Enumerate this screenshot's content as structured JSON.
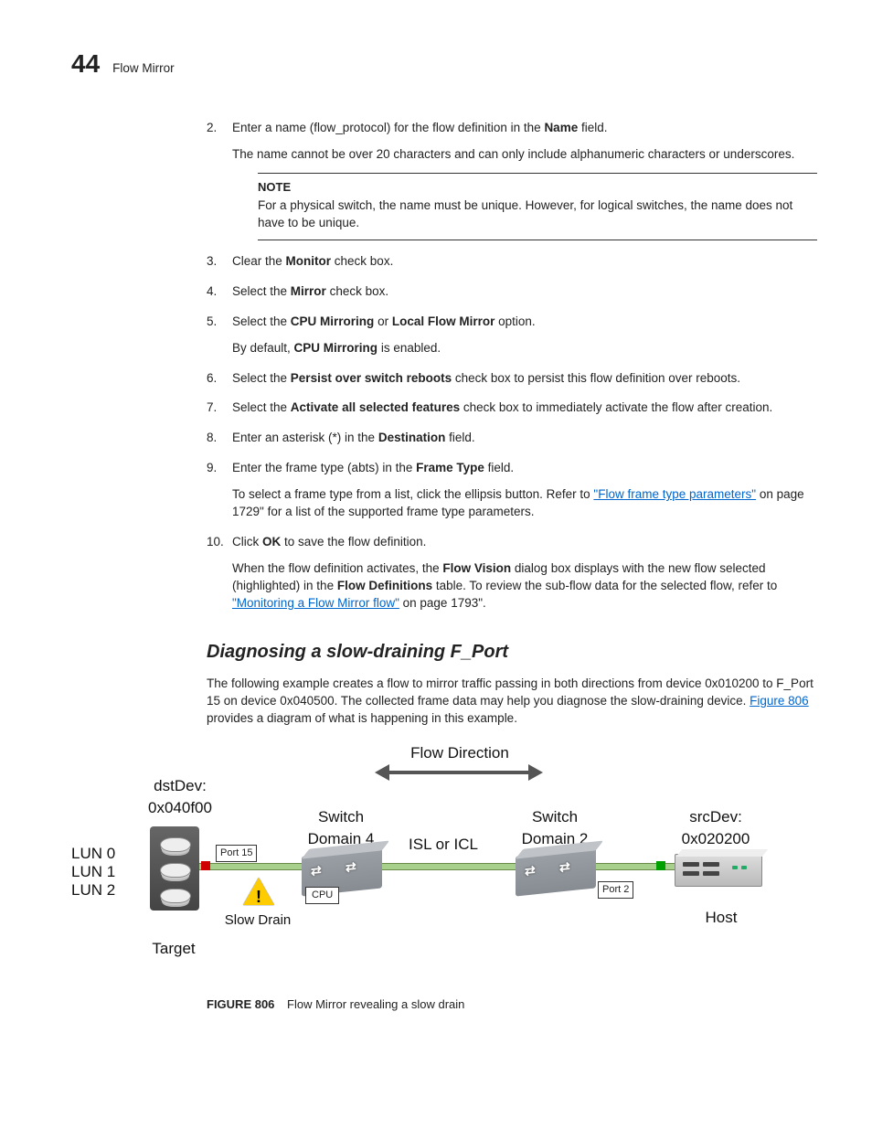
{
  "header": {
    "page_number": "44",
    "section_title": "Flow Mirror"
  },
  "steps": {
    "s2": {
      "num": "2.",
      "text_a": "Enter a name (flow_protocol) for the flow definition in the ",
      "bold_a": "Name",
      "text_b": " field.",
      "para": "The name cannot be over 20 characters and can only include alphanumeric characters or underscores."
    },
    "note": {
      "label": "NOTE",
      "text": "For a physical switch, the name must be unique. However, for logical switches, the name does not have to be unique."
    },
    "s3": {
      "num": "3.",
      "a": "Clear the ",
      "b": "Monitor",
      "c": " check box."
    },
    "s4": {
      "num": "4.",
      "a": "Select the ",
      "b": "Mirror",
      "c": " check box."
    },
    "s5": {
      "num": "5.",
      "a": "Select the ",
      "b": "CPU Mirroring",
      "c": " or ",
      "d": "Local Flow Mirror",
      "e": " option.",
      "para_a": "By default, ",
      "para_b": "CPU Mirroring",
      "para_c": " is enabled."
    },
    "s6": {
      "num": "6.",
      "a": "Select the ",
      "b": "Persist over switch reboots",
      "c": " check box to persist this flow definition over reboots."
    },
    "s7": {
      "num": "7.",
      "a": "Select the ",
      "b": "Activate all selected features",
      "c": " check box to immediately activate the flow after creation."
    },
    "s8": {
      "num": "8.",
      "a": "Enter an asterisk (*) in the ",
      "b": "Destination",
      "c": " field."
    },
    "s9": {
      "num": "9.",
      "a": "Enter the frame type (abts) in the ",
      "b": "Frame Type",
      "c": " field.",
      "para_a": "To select a frame type from a list, click the ellipsis button. Refer to ",
      "link": "\"Flow frame type parameters\"",
      "para_b": " on page 1729\" for a list of the supported frame type parameters."
    },
    "s10": {
      "num": "10.",
      "a": "Click ",
      "b": "OK",
      "c": " to save the flow definition.",
      "para_a": "When the flow definition activates, the ",
      "b2": "Flow Vision",
      "para_b": " dialog box displays with the new flow selected (highlighted) in the ",
      "b3": "Flow Definitions",
      "para_c": " table. To review the sub-flow data for the selected flow, refer to ",
      "link": "\"Monitoring a Flow Mirror flow\"",
      "para_d": " on page 1793\"."
    }
  },
  "section2": {
    "heading": "Diagnosing a slow-draining F_Port",
    "p_a": "The following example creates a flow to mirror traffic passing in both directions from device 0x010200 to F_Port 15 on device 0x040500. The collected frame data may help you diagnose the slow-draining device. ",
    "link": "Figure 806",
    "p_b": " provides a diagram of what is happening in this example."
  },
  "diagram": {
    "flow_direction": "Flow Direction",
    "dst_l1": "dstDev:",
    "dst_l2": "0x040f00",
    "lun0": "LUN 0",
    "lun1": "LUN 1",
    "lun2": "LUN 2",
    "target": "Target",
    "port15": "Port 15",
    "cpu": "CPU",
    "slow_drain": "Slow Drain",
    "switch4_l1": "Switch",
    "switch4_l2": "Domain 4",
    "isl": "ISL or ICL",
    "switch2_l1": "Switch",
    "switch2_l2": "Domain 2",
    "port2": "Port 2",
    "src_l1": "srcDev:",
    "src_l2": "0x020200",
    "host": "Host"
  },
  "figure": {
    "label": "FIGURE 806",
    "caption": "Flow Mirror revealing a slow drain"
  }
}
